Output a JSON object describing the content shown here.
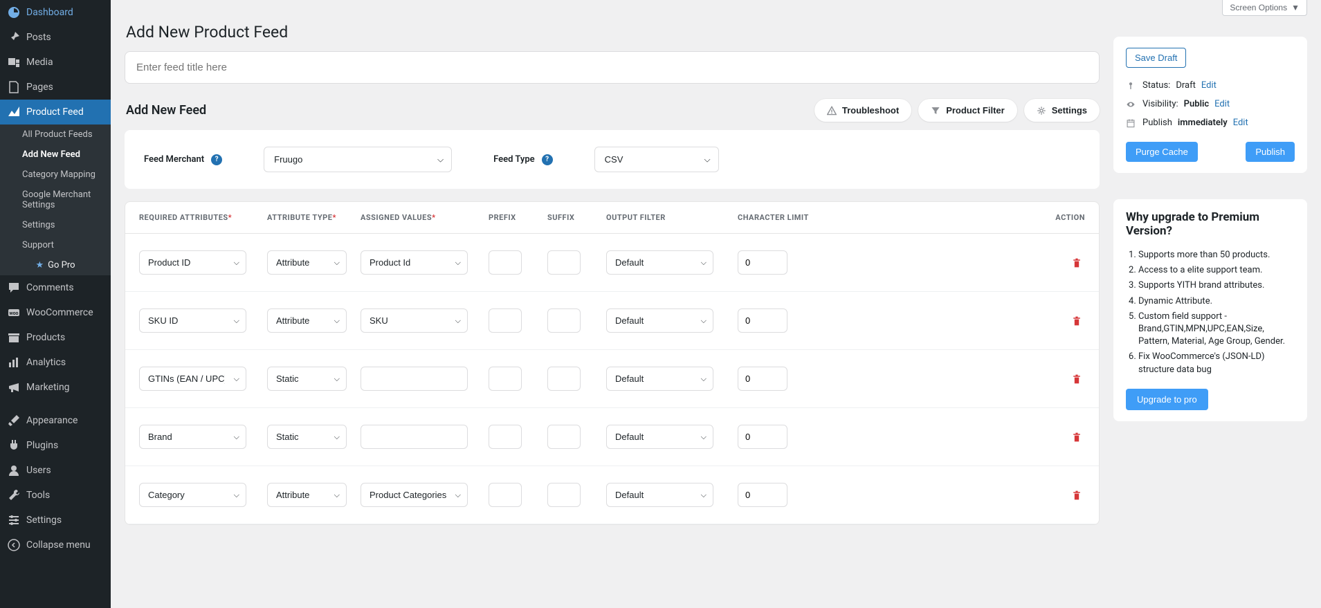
{
  "screenOptions": "Screen Options",
  "sidebar": {
    "items": [
      {
        "label": "Dashboard",
        "icon": "dashboard"
      },
      {
        "label": "Posts",
        "icon": "pin"
      },
      {
        "label": "Media",
        "icon": "media"
      },
      {
        "label": "Pages",
        "icon": "page"
      },
      {
        "label": "Product Feed",
        "icon": "chart",
        "active": true
      },
      {
        "label": "Comments",
        "icon": "comment"
      },
      {
        "label": "WooCommerce",
        "icon": "woo"
      },
      {
        "label": "Products",
        "icon": "archive"
      },
      {
        "label": "Analytics",
        "icon": "bars"
      },
      {
        "label": "Marketing",
        "icon": "megaphone"
      },
      {
        "label": "Appearance",
        "icon": "brush"
      },
      {
        "label": "Plugins",
        "icon": "plug"
      },
      {
        "label": "Users",
        "icon": "user"
      },
      {
        "label": "Tools",
        "icon": "wrench"
      },
      {
        "label": "Settings",
        "icon": "sliders"
      },
      {
        "label": "Collapse menu",
        "icon": "collapse"
      }
    ],
    "submenu": [
      {
        "label": "All Product Feeds"
      },
      {
        "label": "Add New Feed",
        "active": true
      },
      {
        "label": "Category Mapping"
      },
      {
        "label": "Google Merchant Settings"
      },
      {
        "label": "Settings"
      },
      {
        "label": "Support"
      }
    ],
    "goPro": "Go Pro"
  },
  "pageTitle": "Add New Product Feed",
  "feedTitlePlaceholder": "Enter feed title here",
  "sectionTitle": "Add New Feed",
  "actions": {
    "troubleshoot": "Troubleshoot",
    "productFilter": "Product Filter",
    "settings": "Settings"
  },
  "config": {
    "merchantLabel": "Feed Merchant",
    "merchantValue": "Fruugo",
    "typeLabel": "Feed Type",
    "typeValue": "CSV"
  },
  "table": {
    "headers": {
      "required": "REQUIRED ATTRIBUTES",
      "type": "ATTRIBUTE TYPE",
      "assigned": "ASSIGNED VALUES",
      "prefix": "PREFIX",
      "suffix": "SUFFIX",
      "filter": "OUTPUT FILTER",
      "limit": "CHARACTER LIMIT",
      "action": "ACTION"
    },
    "rows": [
      {
        "attr": "Product ID",
        "type": "Attribute",
        "assigned": "Product Id",
        "filter": "Default",
        "limit": "0"
      },
      {
        "attr": "SKU ID",
        "type": "Attribute",
        "assigned": "SKU",
        "filter": "Default",
        "limit": "0"
      },
      {
        "attr": "GTINs (EAN / UPC)",
        "type": "Static",
        "assigned": "",
        "filter": "Default",
        "limit": "0"
      },
      {
        "attr": "Brand",
        "type": "Static",
        "assigned": "",
        "filter": "Default",
        "limit": "0"
      },
      {
        "attr": "Category",
        "type": "Attribute",
        "assigned": "Product Categories",
        "filter": "Default",
        "limit": "0"
      }
    ]
  },
  "publish": {
    "saveDraft": "Save Draft",
    "statusLabel": "Status:",
    "statusValue": "Draft",
    "visibilityLabel": "Visibility:",
    "visibilityValue": "Public",
    "publishLabel": "Publish",
    "publishValue": "immediately",
    "edit": "Edit",
    "purge": "Purge Cache",
    "publishBtn": "Publish"
  },
  "upgrade": {
    "title": "Why upgrade to Premium Version?",
    "items": [
      "Supports more than 50 products.",
      "Access to a elite support team.",
      "Supports YITH brand attributes.",
      "Dynamic Attribute.",
      "Custom field support - Brand,GTIN,MPN,UPC,EAN,Size, Pattern, Material, Age Group, Gender.",
      "Fix WooCommerce's (JSON-LD) structure data bug"
    ],
    "btn": "Upgrade to pro"
  }
}
